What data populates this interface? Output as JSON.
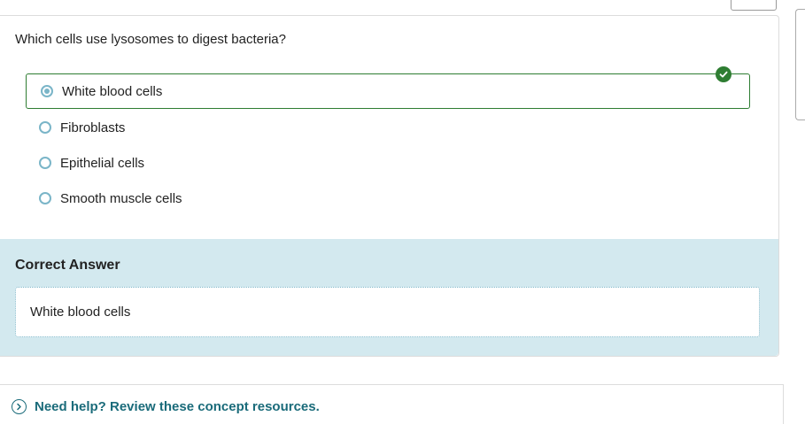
{
  "question": {
    "text": "Which cells use lysosomes to digest bacteria?",
    "options": [
      {
        "label": "White blood cells",
        "selected": true,
        "correct": true
      },
      {
        "label": "Fibroblasts",
        "selected": false
      },
      {
        "label": "Epithelial cells",
        "selected": false
      },
      {
        "label": "Smooth muscle cells",
        "selected": false
      }
    ]
  },
  "answer": {
    "heading": "Correct Answer",
    "value": "White blood cells"
  },
  "help": {
    "link_text": "Need help? Review these concept resources."
  },
  "colors": {
    "correct_green": "#2e7d32",
    "radio_teal": "#7ab5c8",
    "answer_bg": "#d3e9ef",
    "link_teal": "#1a6b7a"
  },
  "icons": {
    "correct": "check-circle-icon",
    "help": "chevron-right-circle-icon"
  }
}
